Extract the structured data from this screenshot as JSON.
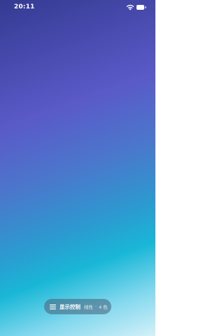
{
  "status_bar": {
    "time": "20:11",
    "icons": [
      "wifi-icon",
      "battery-icon"
    ]
  },
  "background": {
    "type": "linear-gradient",
    "colors": [
      "#343a91",
      "#5a5ac8",
      "#4b77cc",
      "#2b9bd0",
      "#19b7d7",
      "#82d8ee",
      "#d4f1f9"
    ]
  },
  "control_pill": {
    "icon": "menu-icon",
    "title": "显示控制",
    "mode": "线性",
    "separator": "·",
    "colors_label": "4 色"
  }
}
